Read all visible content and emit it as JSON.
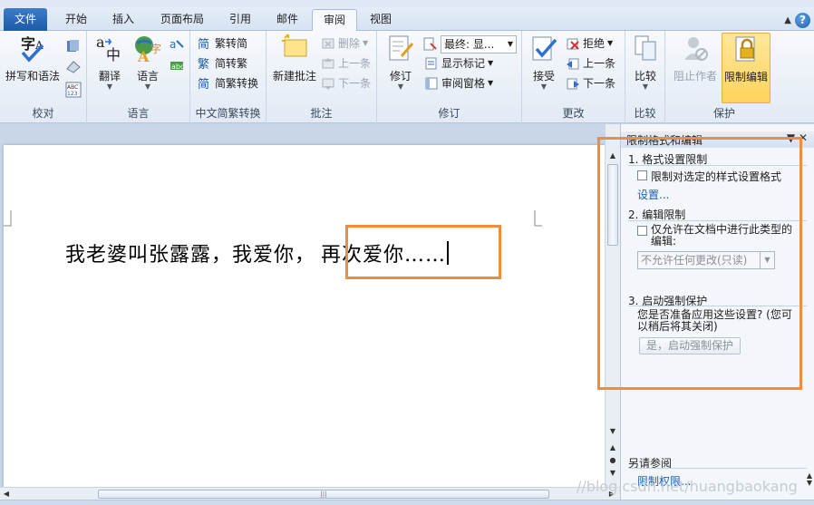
{
  "tabs": {
    "file": "文件",
    "home": "开始",
    "insert": "插入",
    "page_layout": "页面布局",
    "references": "引用",
    "mailings": "邮件",
    "review": "审阅",
    "view": "视图"
  },
  "ribbon": {
    "proofing": {
      "label": "校对",
      "spelling": "拼写和语法"
    },
    "language": {
      "label": "语言",
      "translate": "翻译",
      "language": "语言"
    },
    "chinese": {
      "label": "中文简繁转换",
      "to_simplified": "繁转简",
      "to_traditional": "简转繁",
      "convert": "简繁转换"
    },
    "comments": {
      "label": "批注",
      "new_comment": "新建批注",
      "delete": "删除",
      "previous": "上一条",
      "next": "下一条"
    },
    "tracking": {
      "label": "修订",
      "track_changes": "修订",
      "display": "最终: 显...",
      "show_markup": "显示标记",
      "reviewing_pane": "审阅窗格"
    },
    "changes": {
      "label": "更改",
      "accept": "接受",
      "reject": "拒绝",
      "previous": "上一条",
      "next": "下一条"
    },
    "compare": {
      "label": "比较",
      "compare": "比较"
    },
    "protect": {
      "label": "保护",
      "block_authors": "阻止作者",
      "restrict_editing": "限制编辑"
    }
  },
  "document": {
    "text_plain": "我老婆叫张露露，我爱你，",
    "text_highlight": "再次爱你……"
  },
  "pane": {
    "title": "限制格式和编辑",
    "section1_title": "1. 格式设置限制",
    "section1_checkbox": "限制对选定的样式设置格式",
    "section1_link": "设置...",
    "section2_title": "2. 编辑限制",
    "section2_checkbox_line1": "仅允许在文档中进行此类型的",
    "section2_checkbox_line2": "编辑:",
    "section2_select": "不允许任何更改(只读)",
    "section3_title": "3. 启动强制保护",
    "section3_text_line1": "您是否准备应用这些设置? (您可",
    "section3_text_line2": "以稍后将其关闭)",
    "section3_button": "是，启动强制保护",
    "see_also": "另请参阅",
    "restrict_permission": "限制权限..."
  },
  "watermark": "//blog.csdn.net/huangbaokang",
  "colors": {
    "accent_orange": "#f08c3c",
    "file_tab": "#2a68b8",
    "link": "#1f5fb4"
  }
}
